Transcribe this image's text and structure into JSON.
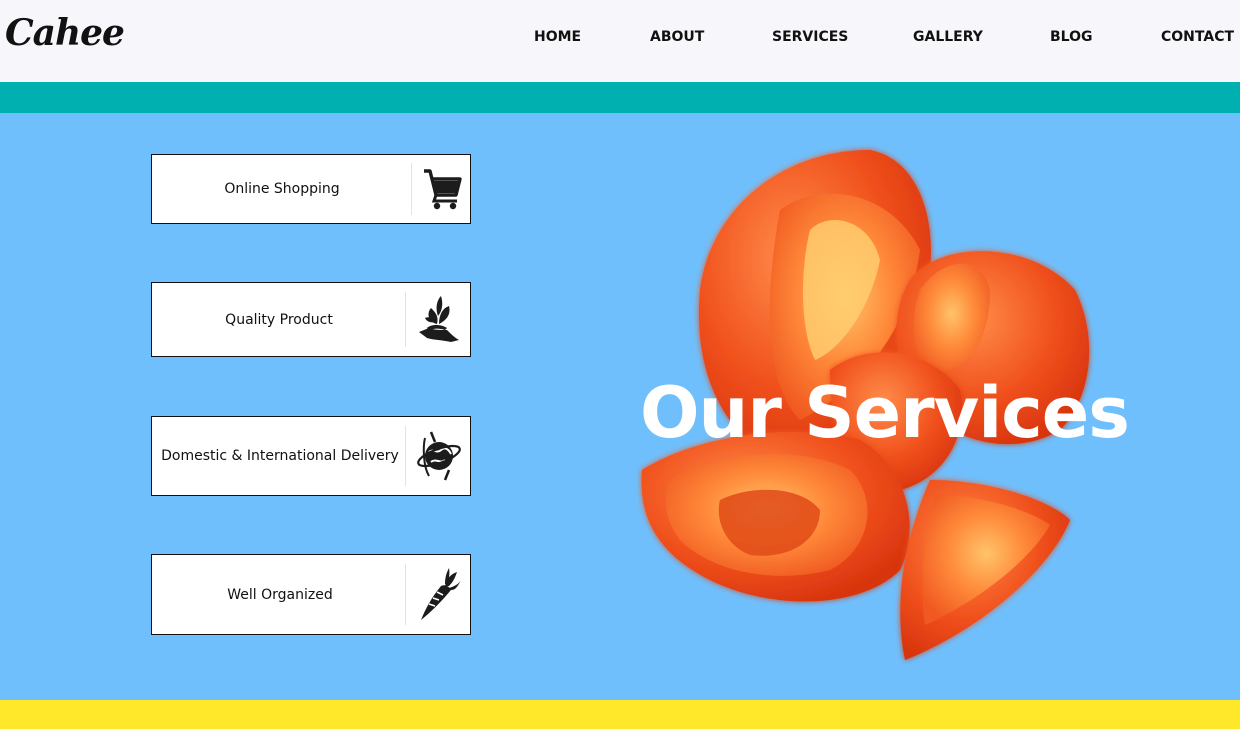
{
  "brand": {
    "logo": "Cahee"
  },
  "nav": {
    "items": [
      "HOME",
      "ABOUT",
      "SERVICES",
      "GALLERY",
      "BLOG",
      "CONTACT"
    ]
  },
  "hero": {
    "title": "Our Services"
  },
  "services": [
    {
      "label": "Online Shopping",
      "icon": "shopping-cart-icon"
    },
    {
      "label": "Quality Product",
      "icon": "plant-in-hand-icon"
    },
    {
      "label": "Domestic & International Delivery",
      "icon": "globe-delivery-icon"
    },
    {
      "label": "Well Organized",
      "icon": "carrot-icon"
    }
  ],
  "colors": {
    "header_bg": "#f7f7fb",
    "teal_band": "#00b0b0",
    "main_bg": "#6fbffc",
    "yellow_band": "#ffe82a",
    "tomato": "#f15a24"
  }
}
